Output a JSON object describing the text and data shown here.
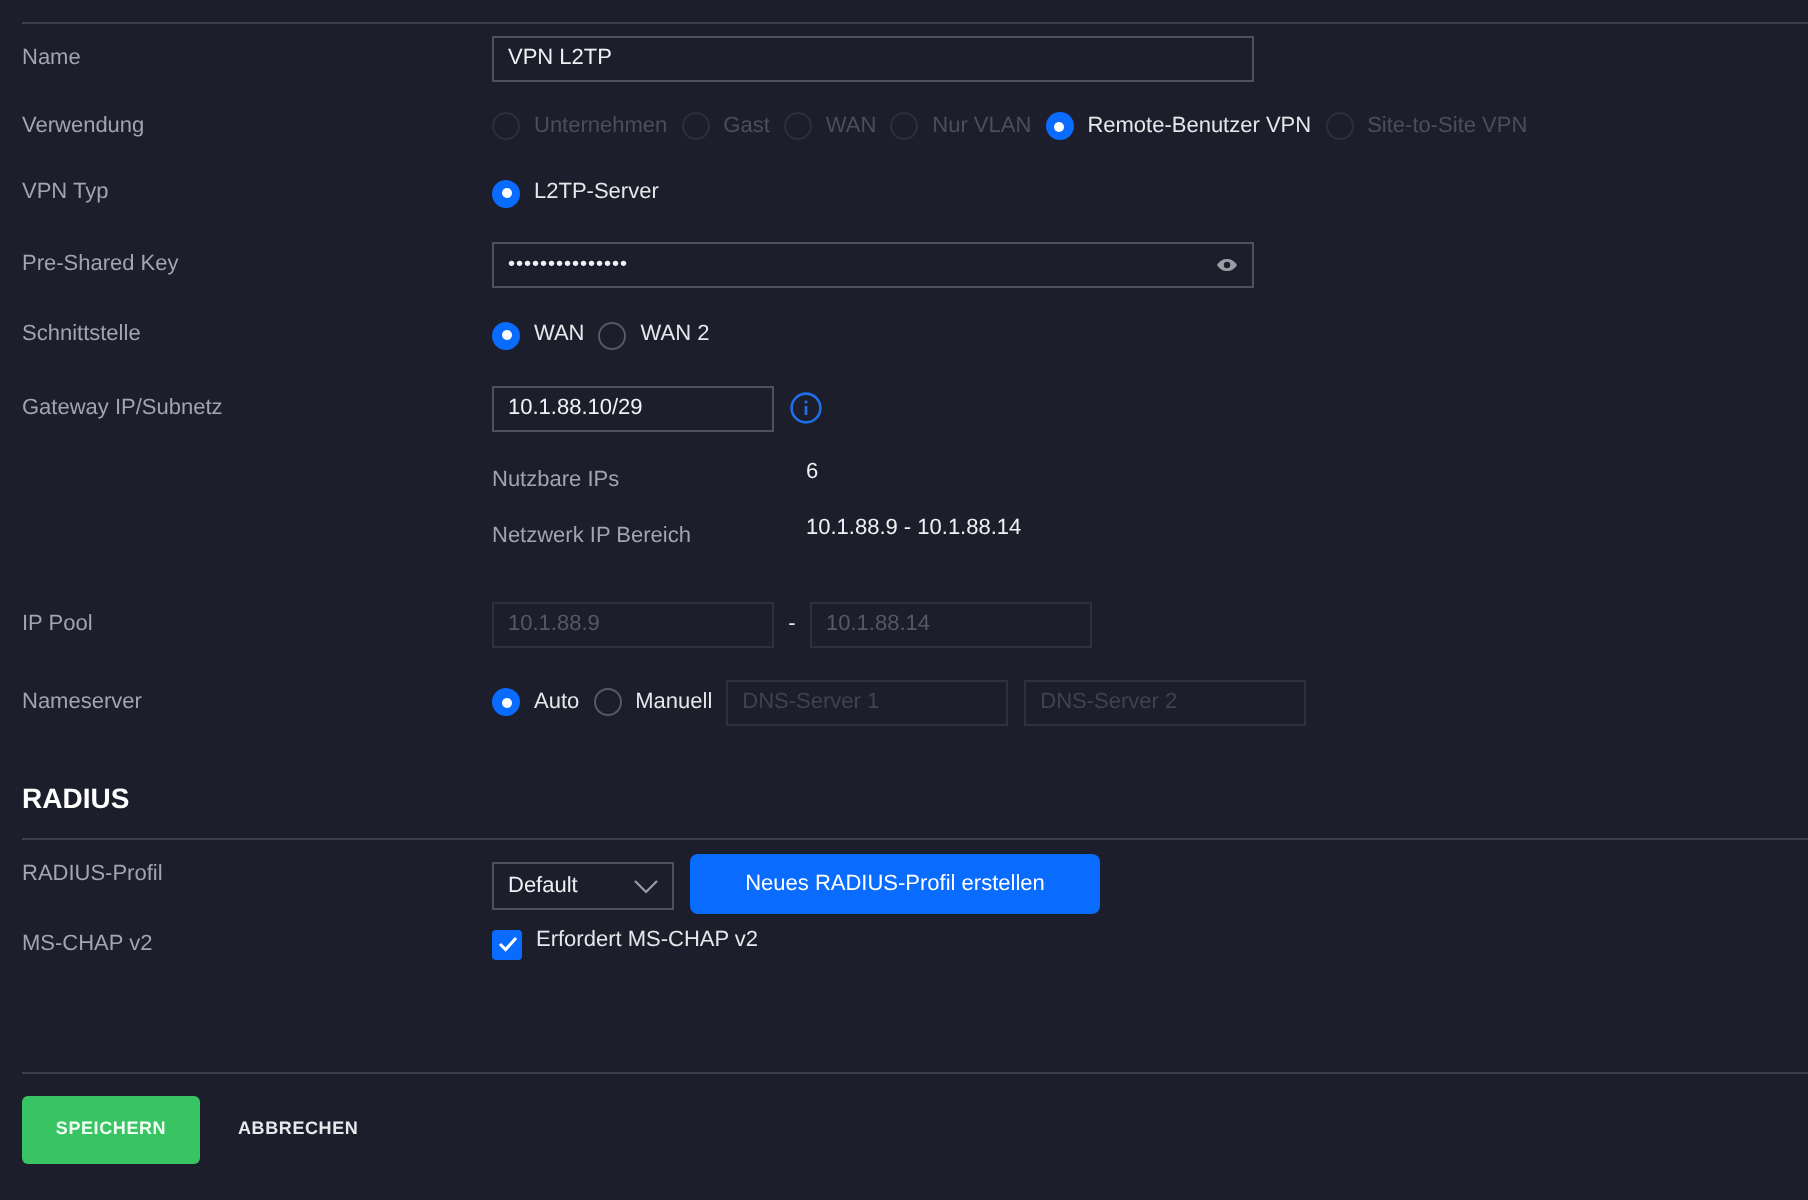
{
  "rows": [
    {
      "kind": "text",
      "label": "Name",
      "value": "VPN L2TP"
    },
    {
      "kind": "radios",
      "label": "Verwendung",
      "options": [
        {
          "label": "Unternehmen",
          "selected": false,
          "disabled": true
        },
        {
          "label": "Gast",
          "selected": false,
          "disabled": true
        },
        {
          "label": "WAN",
          "selected": false,
          "disabled": true
        },
        {
          "label": "Nur VLAN",
          "selected": false,
          "disabled": true
        },
        {
          "label": "Remote-Benutzer VPN",
          "selected": true,
          "disabled": false
        },
        {
          "label": "Site-to-Site VPN",
          "selected": false,
          "disabled": true
        }
      ]
    },
    {
      "kind": "radios",
      "label": "VPN Typ",
      "options": [
        {
          "label": "L2TP-Server",
          "selected": true,
          "disabled": false
        }
      ]
    },
    {
      "kind": "password",
      "label": "Pre-Shared Key",
      "value": "•••••••••••••••"
    },
    {
      "kind": "radios",
      "label": "Schnittstelle",
      "options": [
        {
          "label": "WAN",
          "selected": true,
          "disabled": false
        },
        {
          "label": "WAN 2",
          "selected": false,
          "disabled": false
        }
      ]
    },
    {
      "kind": "info_input",
      "label": "Gateway IP/Subnetz",
      "value": "10.1.88.10/29"
    },
    {
      "kind": "stat",
      "label": "Nutzbare IPs",
      "value": "6"
    },
    {
      "kind": "stat",
      "label": "Netzwerk IP Bereich",
      "value": "10.1.88.9 - 10.1.88.14"
    },
    {
      "kind": "range",
      "label": "IP Pool",
      "start": "10.1.88.9",
      "separator": "-",
      "end": "10.1.88.14"
    },
    {
      "kind": "radios_fields",
      "label": "Nameserver",
      "options": [
        {
          "label": "Auto",
          "selected": true,
          "disabled": false
        },
        {
          "label": "Manuell",
          "selected": false,
          "disabled": false
        }
      ],
      "fields": [
        {
          "placeholder": "DNS-Server 1"
        },
        {
          "placeholder": "DNS-Server 2"
        }
      ]
    }
  ],
  "radius": {
    "title": "RADIUS",
    "profile": {
      "label": "RADIUS-Profil",
      "value": "Default",
      "button": "Neues RADIUS-Profil erstellen"
    },
    "mschap": {
      "label": "MS-CHAP v2",
      "text": "Erfordert MS-CHAP v2",
      "checked": true
    }
  },
  "buttons": [
    {
      "label": "SPEICHERN",
      "kind": "primary"
    },
    {
      "label": "ABBRECHEN",
      "kind": "secondary"
    }
  ]
}
